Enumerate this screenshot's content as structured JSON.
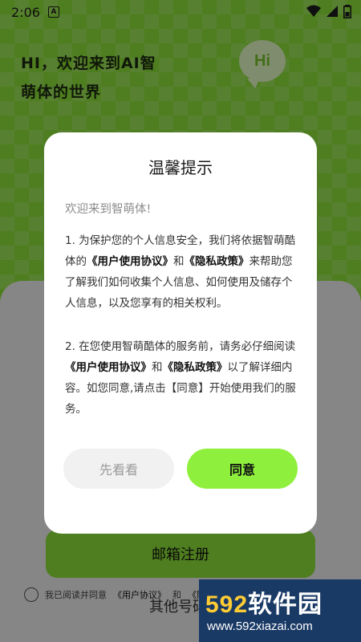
{
  "status_bar": {
    "time": "2:06",
    "notification_icon": "A"
  },
  "header": {
    "welcome_line1": "HI，欢迎来到AI智",
    "welcome_line2": "萌体的世界",
    "bubble_text": "Hi"
  },
  "background": {
    "email_button": "邮箱注册",
    "agree_prefix": "我已阅读并同意",
    "agree_link1": "《用户协议》",
    "agree_mid": "和",
    "agree_link2": "《隐私政策》",
    "other_login": "其他号码登录"
  },
  "dialog": {
    "title": "温馨提示",
    "greeting": "欢迎来到智萌体!",
    "p1_a": "1. 为保护您的个人信息安全，我们将依据智萌酷体的",
    "p1_link1": "《用户使用协议》",
    "p1_b": "和",
    "p1_link2": "《隐私政策》",
    "p1_c": "来帮助您了解我们如何收集个人信息、如何使用及储存个人信息，以及您享有的相关权利。",
    "p2_a": "2. 在您使用智萌酷体的服务前，请务必仔细阅读",
    "p2_link1": "《用户使用协议》",
    "p2_b": "和",
    "p2_link2": "《隐私政策》",
    "p2_c": "以了解详细内容。如您同意,请点击【同意】开始使用我们的服务。",
    "later_button": "先看看",
    "agree_button": "同意"
  },
  "watermark": {
    "main_num": "592",
    "main_text": "软件园",
    "url": "www.592xiazai.com"
  },
  "colors": {
    "accent": "#8ef03c",
    "overlay": "rgba(0,0,0,0.45)"
  }
}
